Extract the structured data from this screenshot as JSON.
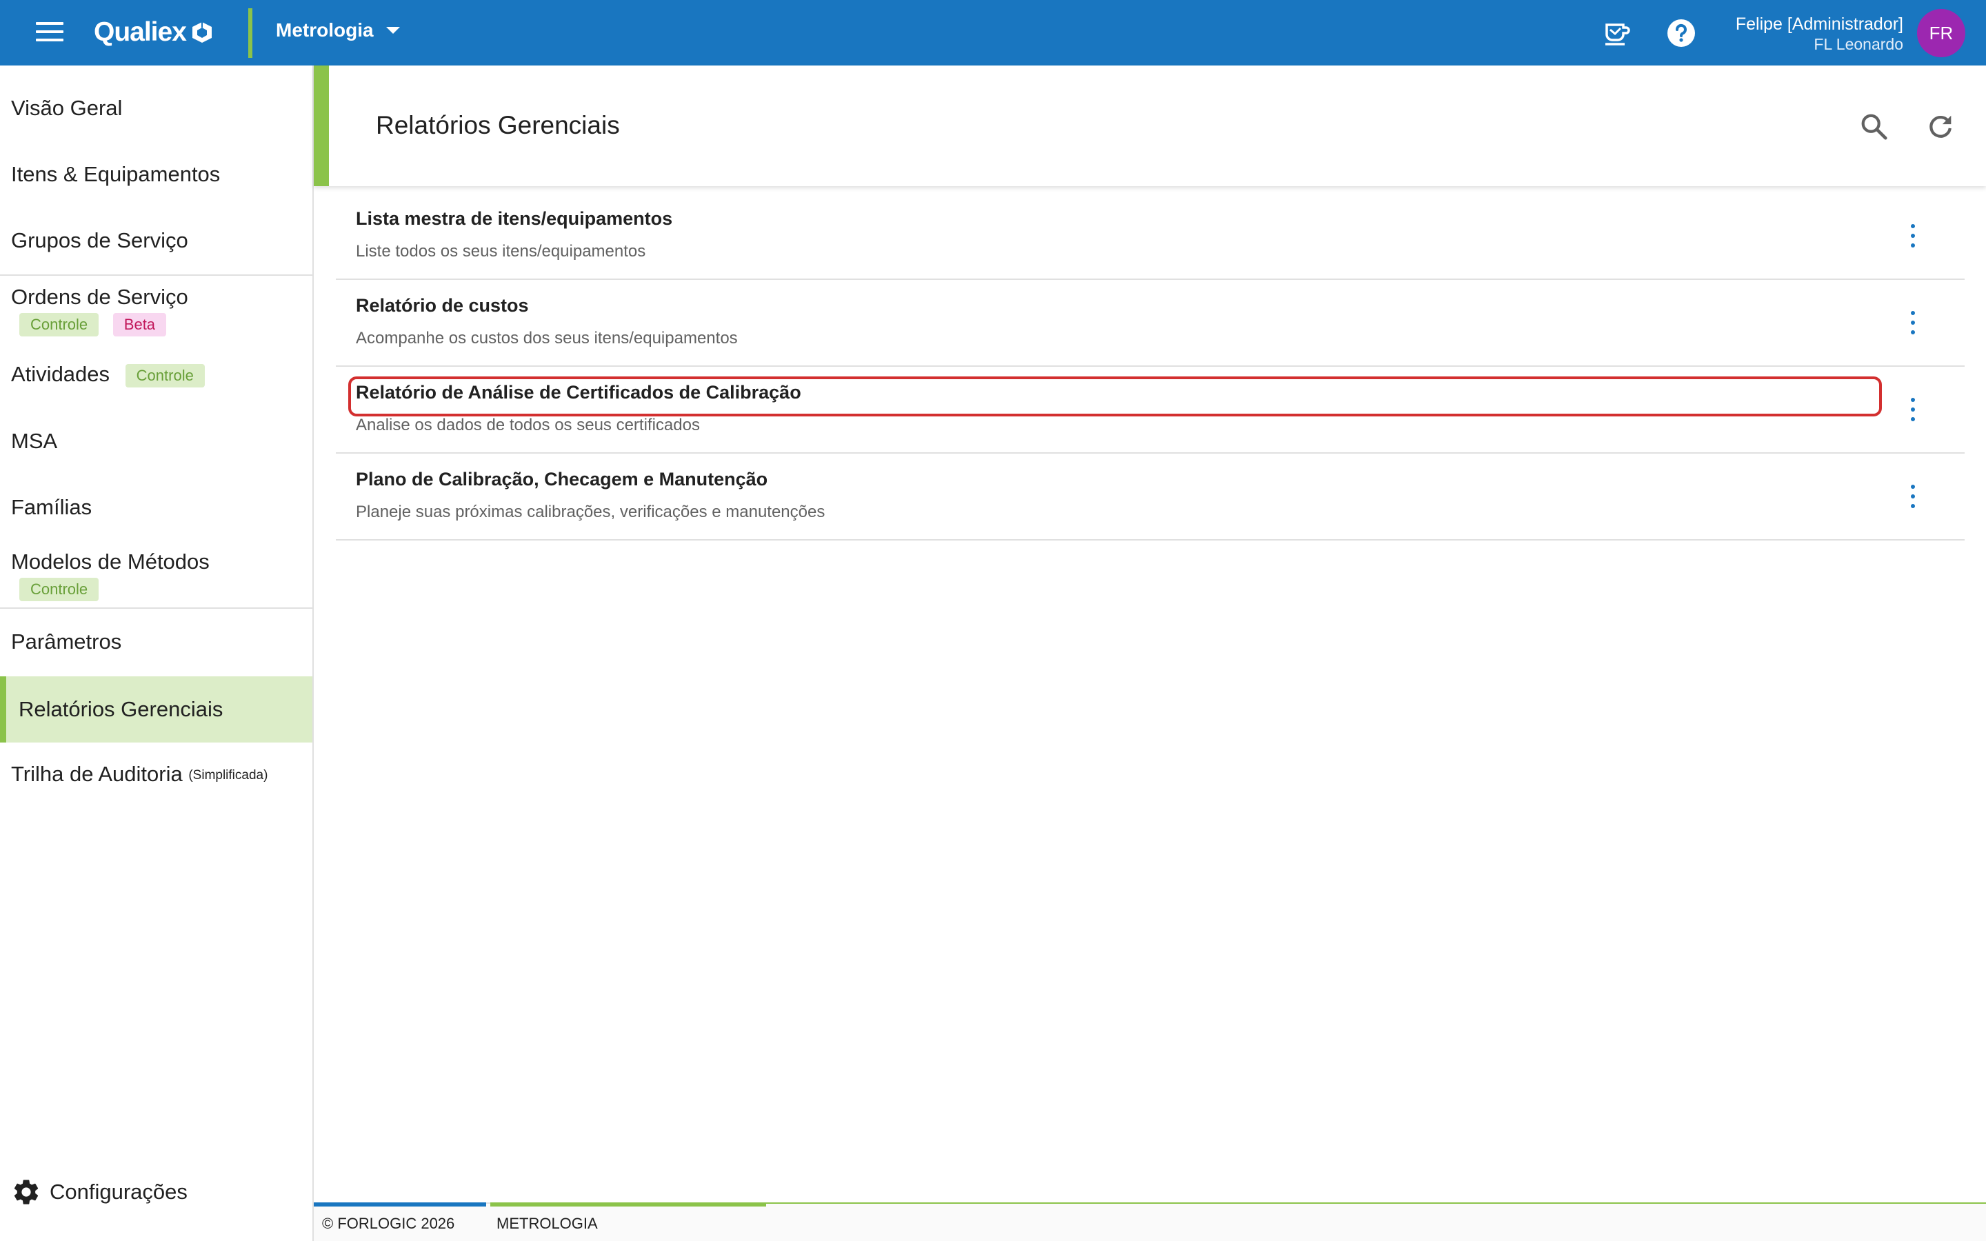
{
  "topbar": {
    "logo_text": "Qualiex",
    "module": "Metrologia",
    "user_name": "Felipe [Administrador]",
    "user_company": "FL Leonardo",
    "avatar_initials": "FR",
    "accent_color": "#1976c0"
  },
  "sidebar": {
    "items": [
      {
        "label": "Visão Geral"
      },
      {
        "label": "Itens & Equipamentos"
      },
      {
        "label": "Grupos de Serviço"
      },
      {
        "label": "Ordens de Serviço",
        "chips": [
          "Controle",
          "Beta"
        ]
      },
      {
        "label": "Atividades",
        "chips": [
          "Controle"
        ]
      },
      {
        "label": "MSA"
      },
      {
        "label": "Famílias"
      },
      {
        "label": "Modelos de Métodos",
        "chips": [
          "Controle"
        ]
      },
      {
        "label": "Parâmetros"
      },
      {
        "label": "Relatórios Gerenciais",
        "active": true
      },
      {
        "label": "Trilha de Auditoria",
        "note": "(Simplificada)"
      }
    ],
    "settings_label": "Configurações"
  },
  "main": {
    "title": "Relatórios Gerenciais",
    "reports": [
      {
        "title": "Lista mestra de itens/equipamentos",
        "desc": "Liste todos os seus itens/equipamentos"
      },
      {
        "title": "Relatório de custos",
        "desc": "Acompanhe os custos dos seus itens/equipamentos"
      },
      {
        "title": "Relatório de Análise de Certificados de Calibração",
        "desc": "Analise os dados de todos os seus certificados",
        "highlighted": true
      },
      {
        "title": "Plano de Calibração, Checagem e Manutenção",
        "desc": "Planeje suas próximas calibrações, verificações e manutenções"
      }
    ]
  },
  "footer": {
    "copyright": "© FORLOGIC 2026",
    "module": "METROLOGIA"
  }
}
